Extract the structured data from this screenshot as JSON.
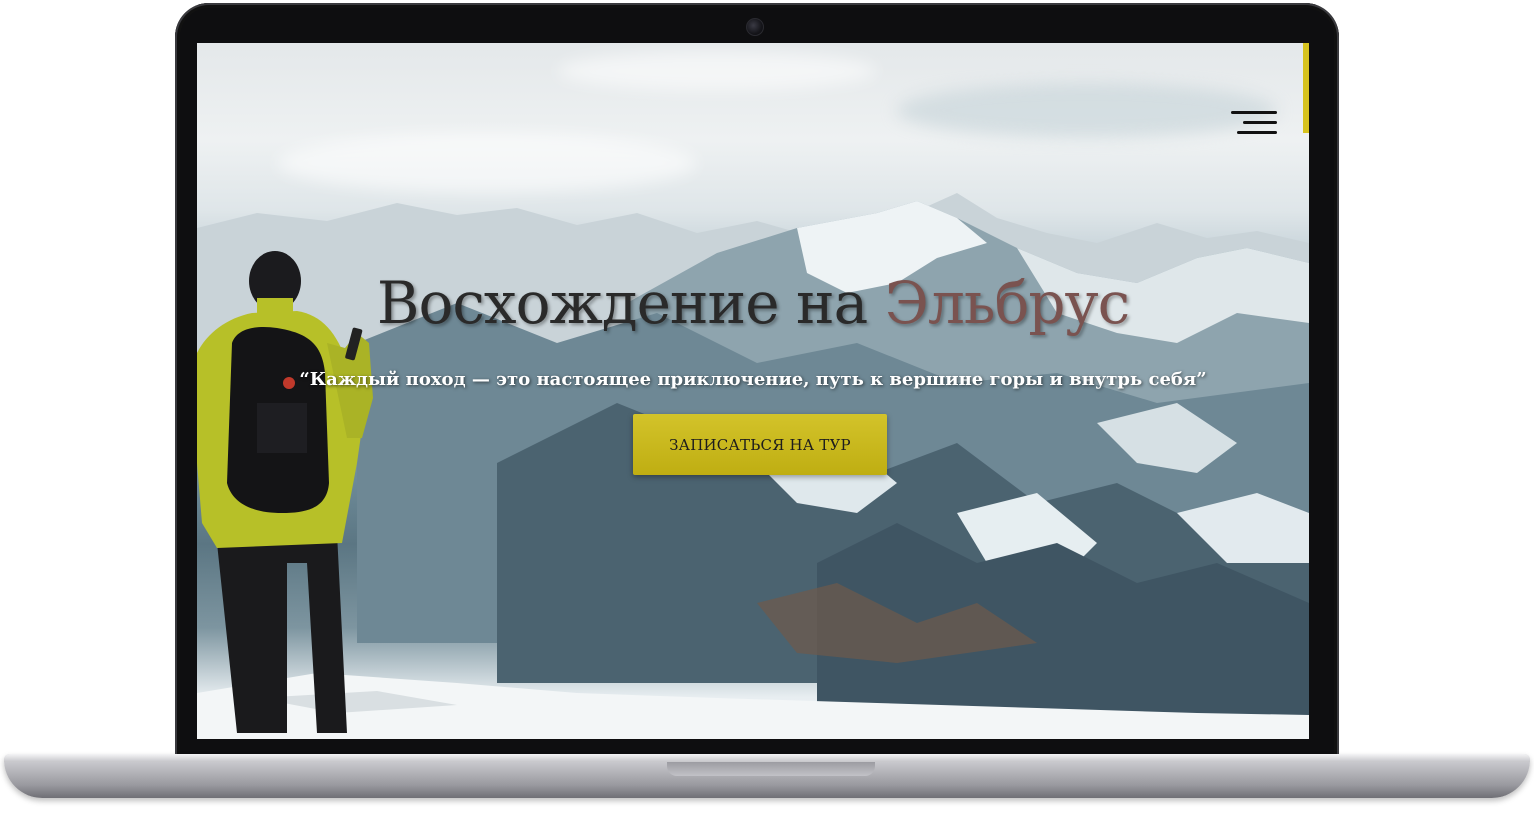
{
  "hero": {
    "title_main": "Восхождение на ",
    "title_accent": "Эльбрус",
    "quote": "“Каждый поход — это настоящее приключение, путь к вершине горы и внутрь себя”",
    "cta_label": "ЗАПИСАТЬСЯ НА ТУР"
  },
  "header": {
    "menu_icon": "hamburger-menu-icon"
  },
  "colors": {
    "accent_yellow": "#c9b81c",
    "title_text": "#2a2a2a",
    "title_accent": "#7a5350",
    "quote_text": "#ffffff",
    "hiker_jacket": "#b9c22a"
  }
}
